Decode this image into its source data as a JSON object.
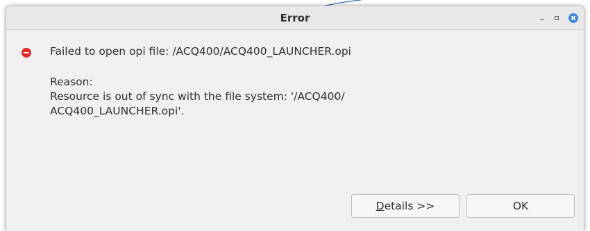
{
  "window": {
    "title": "Error"
  },
  "icons": {
    "minimize": "minimize-icon",
    "maximize": "maximize-icon",
    "close": "close-icon",
    "error": "error-icon"
  },
  "message": {
    "line1": "Failed to open opi file: /ACQ400/ACQ400_LAUNCHER.opi",
    "reason_label": "Reason:",
    "reason_line1": "Resource is out of sync with the file system: '/ACQ400/",
    "reason_line2": "ACQ400_LAUNCHER.opi'."
  },
  "buttons": {
    "details_mnemonic": "D",
    "details_rest": "etails >>",
    "ok": "OK"
  },
  "colors": {
    "close_button": "#3d86e1",
    "error_icon": "#e02a2a",
    "dialog_bg": "#f0f0f0"
  }
}
